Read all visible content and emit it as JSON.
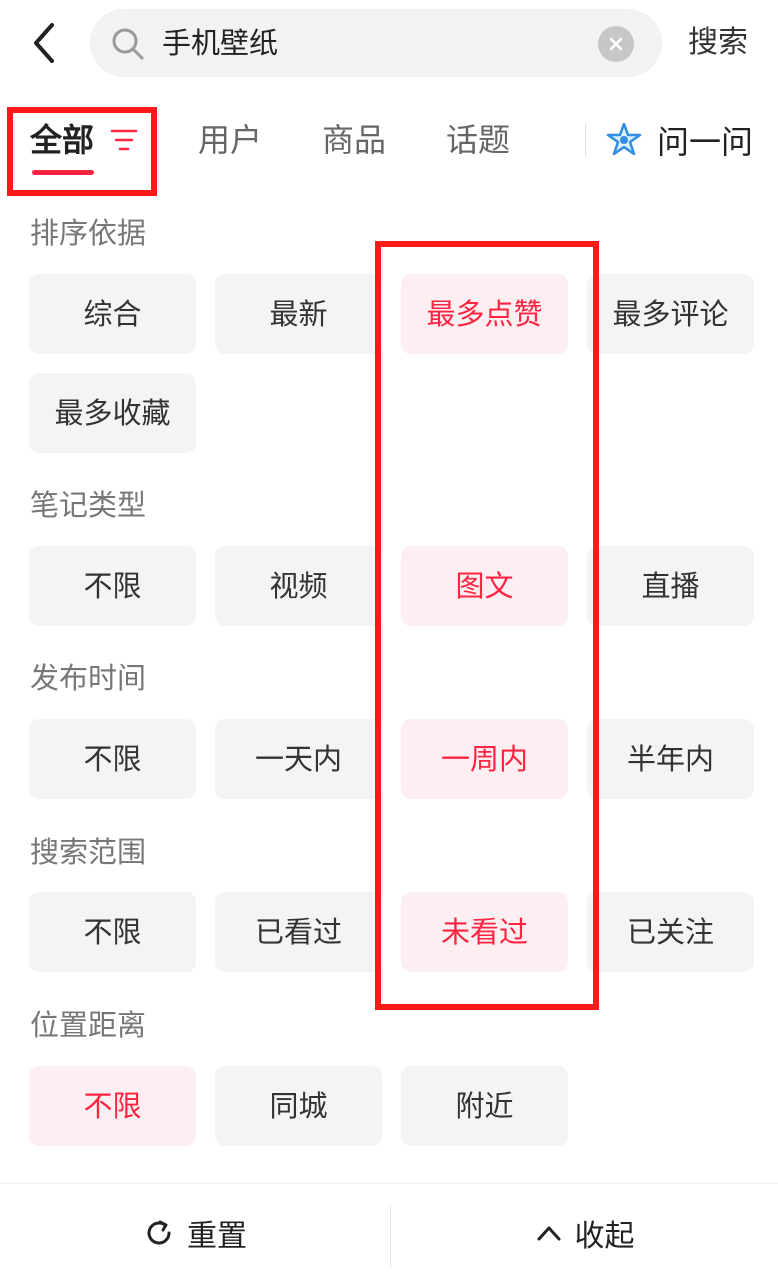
{
  "search": {
    "query": "手机壁纸",
    "submit_label": "搜索"
  },
  "tabs": [
    {
      "label": "全部",
      "active": true
    },
    {
      "label": "用户"
    },
    {
      "label": "商品"
    },
    {
      "label": "话题"
    }
  ],
  "ask": {
    "label": "问一问"
  },
  "sections": [
    {
      "title": "排序依据",
      "options": [
        "综合",
        "最新",
        "最多点赞",
        "最多评论",
        "最多收藏"
      ],
      "selected": "最多点赞"
    },
    {
      "title": "笔记类型",
      "options": [
        "不限",
        "视频",
        "图文",
        "直播"
      ],
      "selected": "图文"
    },
    {
      "title": "发布时间",
      "options": [
        "不限",
        "一天内",
        "一周内",
        "半年内"
      ],
      "selected": "一周内"
    },
    {
      "title": "搜索范围",
      "options": [
        "不限",
        "已看过",
        "未看过",
        "已关注"
      ],
      "selected": "未看过"
    },
    {
      "title": "位置距离",
      "options": [
        "不限",
        "同城",
        "附近"
      ],
      "selected": "不限"
    }
  ],
  "footer": {
    "reset_label": "重置",
    "collapse_label": "收起"
  },
  "colors": {
    "accent": "#ff2442",
    "selected_bg": "#fdeff1",
    "chip_bg": "#f4f4f5",
    "annotation": "#fb1a1a"
  },
  "icons": [
    "back-arrow-icon",
    "search-icon",
    "clear-icon",
    "filter-icon",
    "ask-star-icon",
    "refresh-icon",
    "chevron-up-icon"
  ]
}
